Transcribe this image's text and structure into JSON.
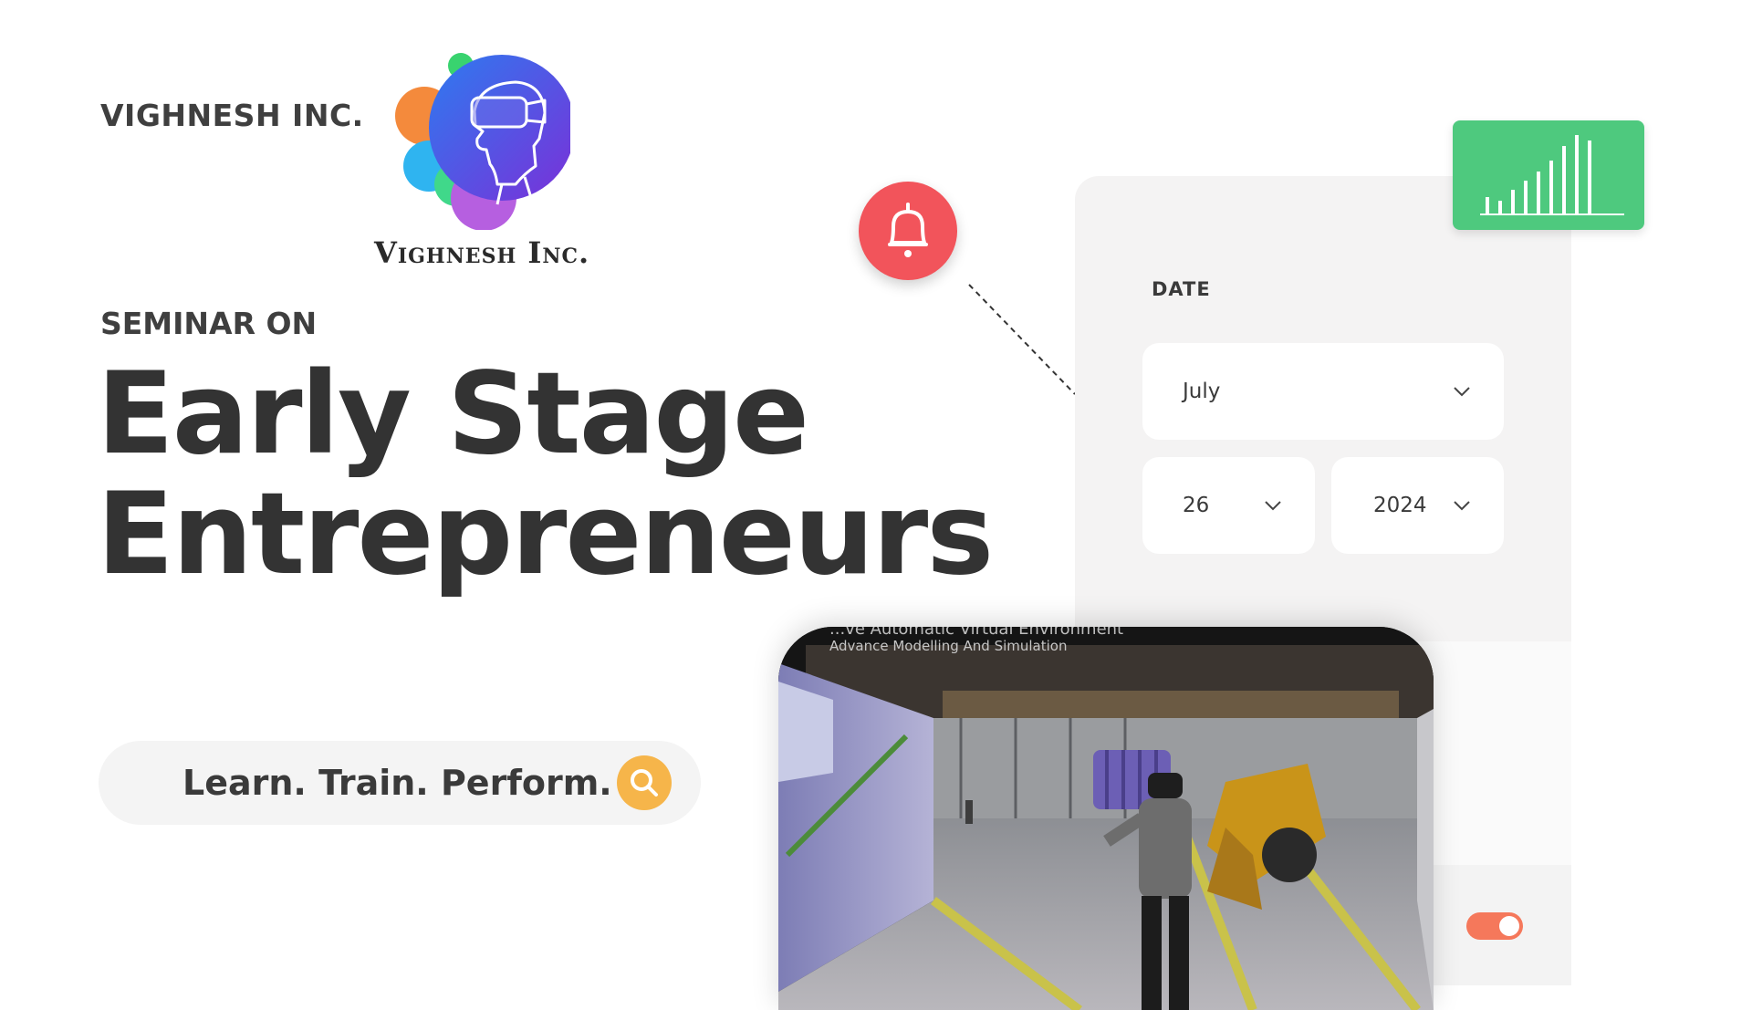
{
  "brand": {
    "name": "VIGHNESH INC.",
    "logo_caption": "Vighnesh Inc."
  },
  "headline": {
    "kicker": "SEMINAR ON",
    "line1": "Early Stage",
    "line2": "Entrepreneurs"
  },
  "tagline": {
    "text": "Learn. Train. Perform."
  },
  "date_panel": {
    "label": "DATE",
    "month": "July",
    "day": "26",
    "year": "2024"
  },
  "photo": {
    "caption_line1": "...ve Automatic Virtual Environment",
    "caption_line2": "Advance Modelling And Simulation"
  },
  "toggle": {
    "state": "on"
  },
  "colors": {
    "bell_bg": "#f2545b",
    "search_bg": "#f6b54a",
    "chart_card_bg": "#4ec97e",
    "toggle_bg": "#f5785b",
    "text_dark": "#333333"
  },
  "icons": {
    "bell": "bell-icon",
    "search": "search-icon",
    "chevron": "chevron-down-icon",
    "chart": "bar-chart-icon"
  }
}
